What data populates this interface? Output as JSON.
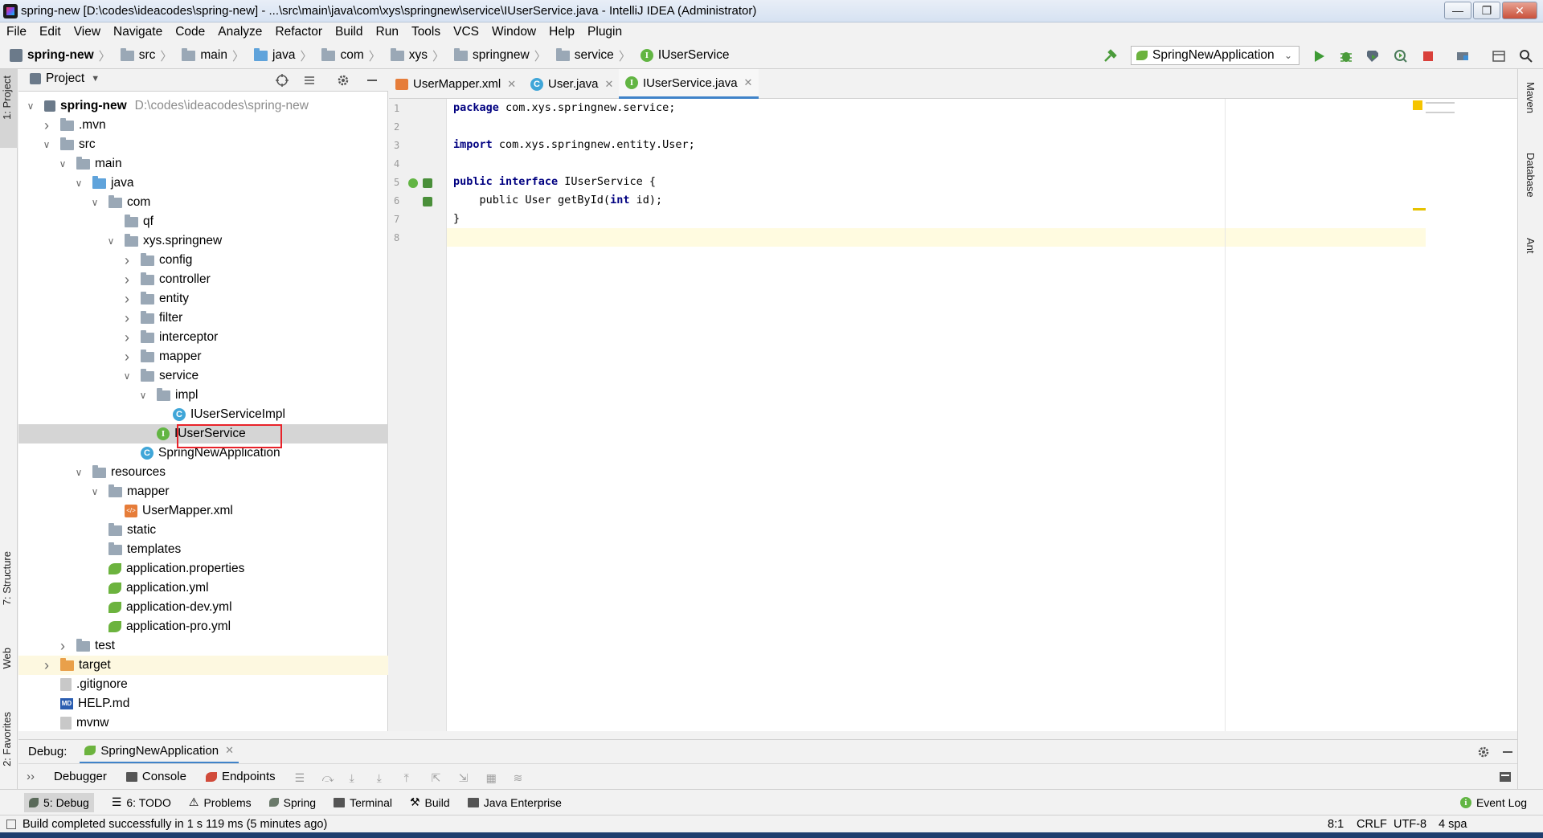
{
  "window": {
    "title": "spring-new [D:\\codes\\ideacodes\\spring-new] - ...\\src\\main\\java\\com\\xys\\springnew\\service\\IUserService.java - IntelliJ IDEA (Administrator)",
    "minimize": "—",
    "maximize": "❐",
    "close": "✕"
  },
  "menu": [
    "File",
    "Edit",
    "View",
    "Navigate",
    "Code",
    "Analyze",
    "Refactor",
    "Build",
    "Run",
    "Tools",
    "VCS",
    "Window",
    "Help",
    "Plugin"
  ],
  "breadcrumb": [
    {
      "label": "spring-new",
      "icon": "project-icon"
    },
    {
      "label": "src",
      "icon": "folder-icon"
    },
    {
      "label": "main",
      "icon": "folder-icon"
    },
    {
      "label": "java",
      "icon": "folder-icon"
    },
    {
      "label": "com",
      "icon": "folder-icon"
    },
    {
      "label": "xys",
      "icon": "folder-icon"
    },
    {
      "label": "springnew",
      "icon": "folder-icon"
    },
    {
      "label": "service",
      "icon": "folder-icon"
    },
    {
      "label": "IUserService",
      "icon": "interface-icon"
    }
  ],
  "run_config": {
    "label": "SpringNewApplication"
  },
  "left_tabs": {
    "project": "1: Project",
    "structure": "7: Structure",
    "web": "Web",
    "favorites": "2: Favorites"
  },
  "right_tabs": {
    "maven": "Maven",
    "database": "Database",
    "ant": "Ant"
  },
  "project_panel": {
    "title": "Project",
    "tree": [
      {
        "label": "spring-new",
        "hint": "D:\\codes\\ideacodes\\spring-new",
        "depth": 0,
        "arrow": "down",
        "icon": "project",
        "bold": true
      },
      {
        "label": ".mvn",
        "depth": 1,
        "arrow": "right",
        "icon": "folder"
      },
      {
        "label": "src",
        "depth": 1,
        "arrow": "down",
        "icon": "folder"
      },
      {
        "label": "main",
        "depth": 2,
        "arrow": "down",
        "icon": "folder"
      },
      {
        "label": "java",
        "depth": 3,
        "arrow": "down",
        "icon": "folder-blue"
      },
      {
        "label": "com",
        "depth": 4,
        "arrow": "down",
        "icon": "folder"
      },
      {
        "label": "qf",
        "depth": 5,
        "arrow": "none",
        "icon": "folder"
      },
      {
        "label": "xys.springnew",
        "depth": 5,
        "arrow": "down",
        "icon": "folder"
      },
      {
        "label": "config",
        "depth": 6,
        "arrow": "right",
        "icon": "folder"
      },
      {
        "label": "controller",
        "depth": 6,
        "arrow": "right",
        "icon": "folder"
      },
      {
        "label": "entity",
        "depth": 6,
        "arrow": "right",
        "icon": "folder"
      },
      {
        "label": "filter",
        "depth": 6,
        "arrow": "right",
        "icon": "folder"
      },
      {
        "label": "interceptor",
        "depth": 6,
        "arrow": "right",
        "icon": "folder"
      },
      {
        "label": "mapper",
        "depth": 6,
        "arrow": "right",
        "icon": "folder"
      },
      {
        "label": "service",
        "depth": 6,
        "arrow": "down",
        "icon": "folder"
      },
      {
        "label": "impl",
        "depth": 7,
        "arrow": "down",
        "icon": "folder"
      },
      {
        "label": "IUserServiceImpl",
        "depth": 8,
        "arrow": "none",
        "icon": "class"
      },
      {
        "label": "IUserService",
        "depth": 7,
        "arrow": "none",
        "icon": "interface",
        "selected": true
      },
      {
        "label": "SpringNewApplication",
        "depth": 6,
        "arrow": "none",
        "icon": "class"
      },
      {
        "label": "resources",
        "depth": 3,
        "arrow": "down",
        "icon": "folder"
      },
      {
        "label": "mapper",
        "depth": 4,
        "arrow": "down",
        "icon": "folder"
      },
      {
        "label": "UserMapper.xml",
        "depth": 5,
        "arrow": "none",
        "icon": "xml"
      },
      {
        "label": "static",
        "depth": 4,
        "arrow": "none",
        "icon": "folder"
      },
      {
        "label": "templates",
        "depth": 4,
        "arrow": "none",
        "icon": "folder"
      },
      {
        "label": "application.properties",
        "depth": 4,
        "arrow": "none",
        "icon": "leaf"
      },
      {
        "label": "application.yml",
        "depth": 4,
        "arrow": "none",
        "icon": "leaf"
      },
      {
        "label": "application-dev.yml",
        "depth": 4,
        "arrow": "none",
        "icon": "leaf"
      },
      {
        "label": "application-pro.yml",
        "depth": 4,
        "arrow": "none",
        "icon": "leaf"
      },
      {
        "label": "test",
        "depth": 2,
        "arrow": "right",
        "icon": "folder"
      },
      {
        "label": "target",
        "depth": 1,
        "arrow": "right",
        "icon": "folder-orange",
        "target": true
      },
      {
        "label": ".gitignore",
        "depth": 1,
        "arrow": "none",
        "icon": "file"
      },
      {
        "label": "HELP.md",
        "depth": 1,
        "arrow": "none",
        "icon": "md"
      },
      {
        "label": "mvnw",
        "depth": 1,
        "arrow": "none",
        "icon": "file"
      }
    ]
  },
  "editor_tabs": [
    {
      "label": "UserMapper.xml",
      "icon": "xml",
      "active": false
    },
    {
      "label": "User.java",
      "icon": "class",
      "active": false
    },
    {
      "label": "IUserService.java",
      "icon": "interface",
      "active": true
    }
  ],
  "code": {
    "line_numbers": [
      "1",
      "2",
      "3",
      "4",
      "5",
      "6",
      "7",
      "8"
    ],
    "lines": [
      [
        {
          "t": "package",
          "kw": true
        },
        {
          "t": " com.xys.springnew.service;"
        }
      ],
      [],
      [
        {
          "t": "import",
          "kw": true
        },
        {
          "t": " com.xys.springnew.entity.User;"
        }
      ],
      [],
      [
        {
          "t": "public",
          "kw": true
        },
        {
          "t": " "
        },
        {
          "t": "interface",
          "kw": true
        },
        {
          "t": " IUserService {"
        }
      ],
      [
        {
          "t": "    public User getById("
        },
        {
          "t": "int",
          "kw": true
        },
        {
          "t": " id);"
        }
      ],
      [
        {
          "t": "}"
        }
      ],
      []
    ]
  },
  "debug": {
    "label": "Debug:",
    "session": "SpringNewApplication",
    "tabs": [
      "Debugger",
      "Console",
      "Endpoints"
    ]
  },
  "tool_buttons": [
    "5: Debug",
    "6: TODO",
    "Problems",
    "Spring",
    "Terminal",
    "Build",
    "Java Enterprise"
  ],
  "event_log": "Event Log",
  "status": {
    "message": "Build completed successfully in 1 s 119 ms (5 minutes ago)",
    "position": "8:1",
    "line_sep": "CRLF",
    "encoding": "UTF-8",
    "indent": "4 spa"
  },
  "colors": {
    "accent": "#4083c9",
    "interface": "#62b543",
    "class": "#40a6d8",
    "highlight_box": "#e8232a",
    "keyword": "#000080"
  }
}
